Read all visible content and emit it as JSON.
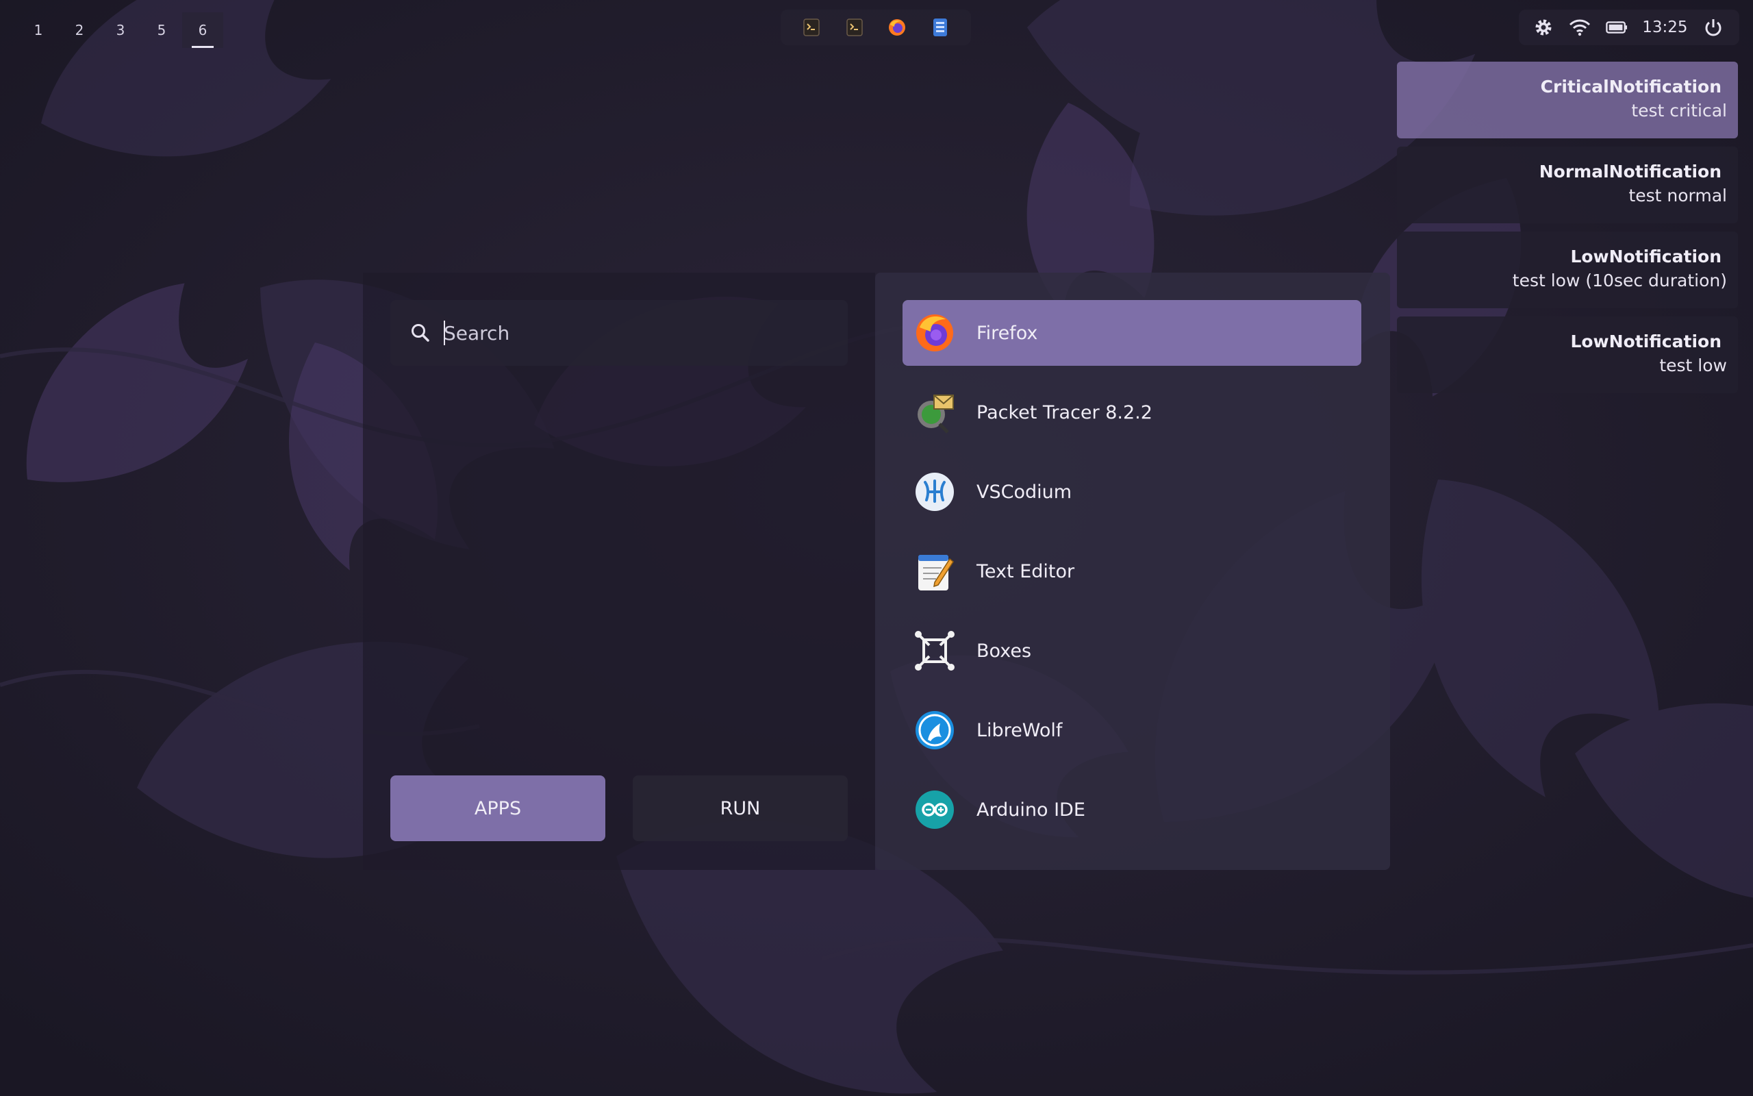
{
  "workspaces": [
    {
      "label": "1"
    },
    {
      "label": "2"
    },
    {
      "label": "3"
    },
    {
      "label": "5"
    },
    {
      "label": "6",
      "active": true
    }
  ],
  "taskbar": {
    "icons": [
      "terminal-icon",
      "terminal-icon",
      "firefox-icon",
      "file-manager-icon"
    ]
  },
  "tray": {
    "icons": [
      "gear-icon",
      "wifi-icon",
      "battery-icon",
      "power-icon"
    ],
    "clock": "13:25"
  },
  "notifications": [
    {
      "title": "CriticalNotification",
      "body": "test critical",
      "urgency": "critical"
    },
    {
      "title": "NormalNotification",
      "body": "test normal",
      "urgency": "normal"
    },
    {
      "title": "LowNotification",
      "body": "test low (10sec duration)",
      "urgency": "low"
    },
    {
      "title": "LowNotification",
      "body": "test low",
      "urgency": "low"
    }
  ],
  "launcher": {
    "search": {
      "placeholder": "Search",
      "value": ""
    },
    "modes": {
      "apps_label": "APPS",
      "run_label": "RUN",
      "active": "APPS"
    },
    "apps": [
      {
        "label": "Firefox",
        "icon": "firefox-icon",
        "selected": true
      },
      {
        "label": "Packet Tracer 8.2.2",
        "icon": "packet-tracer-icon"
      },
      {
        "label": "VSCodium",
        "icon": "vscodium-icon"
      },
      {
        "label": "Text Editor",
        "icon": "text-editor-icon"
      },
      {
        "label": "Boxes",
        "icon": "boxes-icon"
      },
      {
        "label": "LibreWolf",
        "icon": "librewolf-icon"
      },
      {
        "label": "Arduino IDE",
        "icon": "arduino-icon"
      }
    ]
  },
  "colors": {
    "accent": "#7e6fa8",
    "panel": "#302c40",
    "background": "#1f1b2b"
  }
}
